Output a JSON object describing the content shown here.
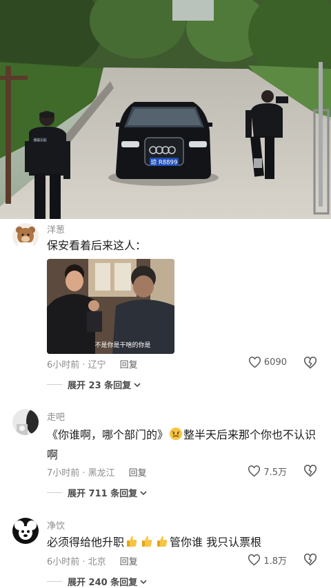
{
  "video": {
    "plate": "琼 R8899",
    "guard_badge": "保安人员"
  },
  "comments": [
    {
      "username": "洋葱",
      "text": "保安看着后来这人：",
      "image_caption": "不是你是干啥的你是",
      "time_loc": "6小时前 · 辽宁",
      "reply_label": "回复",
      "likes": "6090",
      "expand": "展开 23 条回复"
    },
    {
      "username": "走吧",
      "text_part1": "《你谁啊，哪个部门的》",
      "text_part2": "整半天后来那个你也不认识啊",
      "time_loc": "7小时前 · 黑龙江",
      "reply_label": "回复",
      "likes": "7.5万",
      "expand": "展开 711 条回复"
    },
    {
      "username": "净饮",
      "text_part1": "必须得给他升职",
      "text_part2": "管你谁 我只认票根",
      "time_loc": "6小时前 · 北京",
      "reply_label": "回复",
      "likes": "1.8万",
      "expand": "展开 240 条回复"
    }
  ],
  "icons": {
    "heart": "heart-outline-icon",
    "dislike": "broken-heart-icon",
    "chevron": "chevron-down-icon",
    "thumbs": "thumbs-up-emoji",
    "angry": "angry-face-emoji"
  },
  "colors": {
    "name_gray": "#8a8a8a",
    "meta_gray": "#8c8c8c",
    "text": "#1b1b1b"
  }
}
